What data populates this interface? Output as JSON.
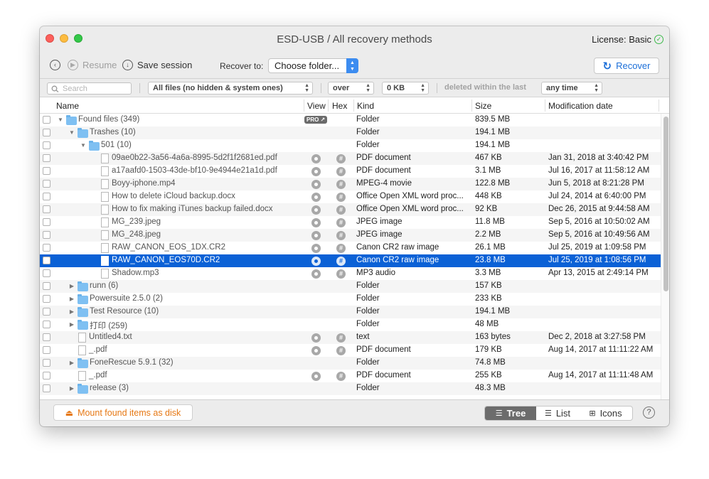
{
  "window": {
    "title": "ESD-USB / All recovery methods",
    "license": "License: Basic",
    "license_icon": "checkmark-circle-icon"
  },
  "toolbar": {
    "back_icon": "back-arrow-icon",
    "resume_label": "Resume",
    "save_session_label": "Save session",
    "recover_to_label": "Recover to:",
    "folder_value": "Choose folder...",
    "recover_label": "Recover"
  },
  "filter": {
    "search_placeholder": "Search",
    "file_filter": "All files (no hidden & system ones)",
    "size_op": "over",
    "size_value": "0 KB",
    "deleted_label": "deleted within the last",
    "time_value": "any time"
  },
  "table": {
    "columns": [
      "Name",
      "View",
      "Hex",
      "Kind",
      "Size",
      "Modification date"
    ],
    "pro_badge": "PRO ↗",
    "rows": [
      {
        "indent": 0,
        "disc": "down",
        "icon": "folder",
        "name": "Found files (349)",
        "pro": true,
        "view": false,
        "hex": false,
        "kind": "Folder",
        "size": "839.5 MB",
        "date": ""
      },
      {
        "indent": 1,
        "disc": "down",
        "icon": "folder",
        "name": "Trashes (10)",
        "view": false,
        "hex": false,
        "kind": "Folder",
        "size": "194.1 MB",
        "date": ""
      },
      {
        "indent": 2,
        "disc": "down",
        "icon": "folder",
        "name": "501 (10)",
        "view": false,
        "hex": false,
        "kind": "Folder",
        "size": "194.1 MB",
        "date": ""
      },
      {
        "indent": 3,
        "disc": "",
        "icon": "doc",
        "name": "09ae0b22-3a56-4a6a-8995-5d2f1f2681ed.pdf",
        "view": true,
        "hex": true,
        "kind": "PDF document",
        "size": "467 KB",
        "date": "Jan 31, 2018 at 3:40:42 PM"
      },
      {
        "indent": 3,
        "disc": "",
        "icon": "doc",
        "name": "a17aafd0-1503-43de-bf10-9e4944e21a1d.pdf",
        "view": true,
        "hex": true,
        "kind": "PDF document",
        "size": "3.1 MB",
        "date": "Jul 16, 2017 at 11:58:12 AM"
      },
      {
        "indent": 3,
        "disc": "",
        "icon": "doc",
        "name": "Boyy-iphone.mp4",
        "view": true,
        "hex": true,
        "kind": "MPEG-4 movie",
        "size": "122.8 MB",
        "date": "Jun 5, 2018 at 8:21:28 PM"
      },
      {
        "indent": 3,
        "disc": "",
        "icon": "doc",
        "name": "How to delete iCloud backup.docx",
        "view": true,
        "hex": true,
        "kind": "Office Open XML word proc...",
        "size": "448 KB",
        "date": "Jul 24, 2014 at 6:40:00 PM"
      },
      {
        "indent": 3,
        "disc": "",
        "icon": "doc",
        "name": "How to fix making iTunes backup failed.docx",
        "view": true,
        "hex": true,
        "kind": "Office Open XML word proc...",
        "size": "92 KB",
        "date": "Dec 26, 2015 at 9:44:58 AM"
      },
      {
        "indent": 3,
        "disc": "",
        "icon": "doc",
        "name": "MG_239.jpeg",
        "view": true,
        "hex": true,
        "kind": "JPEG image",
        "size": "11.8 MB",
        "date": "Sep 5, 2016 at 10:50:02 AM"
      },
      {
        "indent": 3,
        "disc": "",
        "icon": "doc",
        "name": "MG_248.jpeg",
        "view": true,
        "hex": true,
        "kind": "JPEG image",
        "size": "2.2 MB",
        "date": "Sep 5, 2016 at 10:49:56 AM"
      },
      {
        "indent": 3,
        "disc": "",
        "icon": "doc",
        "name": "RAW_CANON_EOS_1DX.CR2",
        "view": true,
        "hex": true,
        "kind": "Canon CR2 raw image",
        "size": "26.1 MB",
        "date": "Jul 25, 2019 at 1:09:58 PM"
      },
      {
        "indent": 3,
        "disc": "",
        "icon": "doc",
        "name": "RAW_CANON_EOS70D.CR2",
        "view": true,
        "hex": true,
        "kind": "Canon CR2 raw image",
        "size": "23.8 MB",
        "date": "Jul 25, 2019 at 1:08:56 PM",
        "selected": true
      },
      {
        "indent": 3,
        "disc": "",
        "icon": "doc",
        "name": "Shadow.mp3",
        "view": true,
        "hex": true,
        "kind": "MP3 audio",
        "size": "3.3 MB",
        "date": "Apr 13, 2015 at 2:49:14 PM"
      },
      {
        "indent": 1,
        "disc": "right",
        "icon": "folder",
        "name": "runn (6)",
        "view": false,
        "hex": false,
        "kind": "Folder",
        "size": "157 KB",
        "date": ""
      },
      {
        "indent": 1,
        "disc": "right",
        "icon": "folder",
        "name": "Powersuite 2.5.0 (2)",
        "view": false,
        "hex": false,
        "kind": "Folder",
        "size": "233 KB",
        "date": ""
      },
      {
        "indent": 1,
        "disc": "right",
        "icon": "folder",
        "name": "Test Resource (10)",
        "view": false,
        "hex": false,
        "kind": "Folder",
        "size": "194.1 MB",
        "date": ""
      },
      {
        "indent": 1,
        "disc": "right",
        "icon": "folder",
        "name": "打印 (259)",
        "view": false,
        "hex": false,
        "kind": "Folder",
        "size": "48 MB",
        "date": ""
      },
      {
        "indent": 1,
        "disc": "",
        "icon": "doc",
        "name": "Untitled4.txt",
        "view": true,
        "hex": true,
        "kind": "text",
        "size": "163 bytes",
        "date": "Dec 2, 2018 at 3:27:58 PM"
      },
      {
        "indent": 1,
        "disc": "",
        "icon": "doc",
        "name": "_.pdf",
        "view": true,
        "hex": true,
        "kind": "PDF document",
        "size": "179 KB",
        "date": "Aug 14, 2017 at 11:11:22 AM"
      },
      {
        "indent": 1,
        "disc": "right",
        "icon": "folder",
        "name": "FoneRescue 5.9.1 (32)",
        "view": false,
        "hex": false,
        "kind": "Folder",
        "size": "74.8 MB",
        "date": ""
      },
      {
        "indent": 1,
        "disc": "",
        "icon": "doc",
        "name": "_.pdf",
        "view": true,
        "hex": true,
        "kind": "PDF document",
        "size": "255 KB",
        "date": "Aug 14, 2017 at 11:11:48 AM"
      },
      {
        "indent": 1,
        "disc": "right",
        "icon": "folder",
        "name": "release (3)",
        "view": false,
        "hex": false,
        "kind": "Folder",
        "size": "48.3 MB",
        "date": ""
      }
    ]
  },
  "bottom": {
    "mount_label": "Mount found items as disk",
    "tree_label": "Tree",
    "list_label": "List",
    "icons_label": "Icons",
    "help": "?"
  },
  "colors": {
    "accent": "#0b61d6",
    "recover": "#1c6fd8",
    "mount": "#e67814"
  }
}
